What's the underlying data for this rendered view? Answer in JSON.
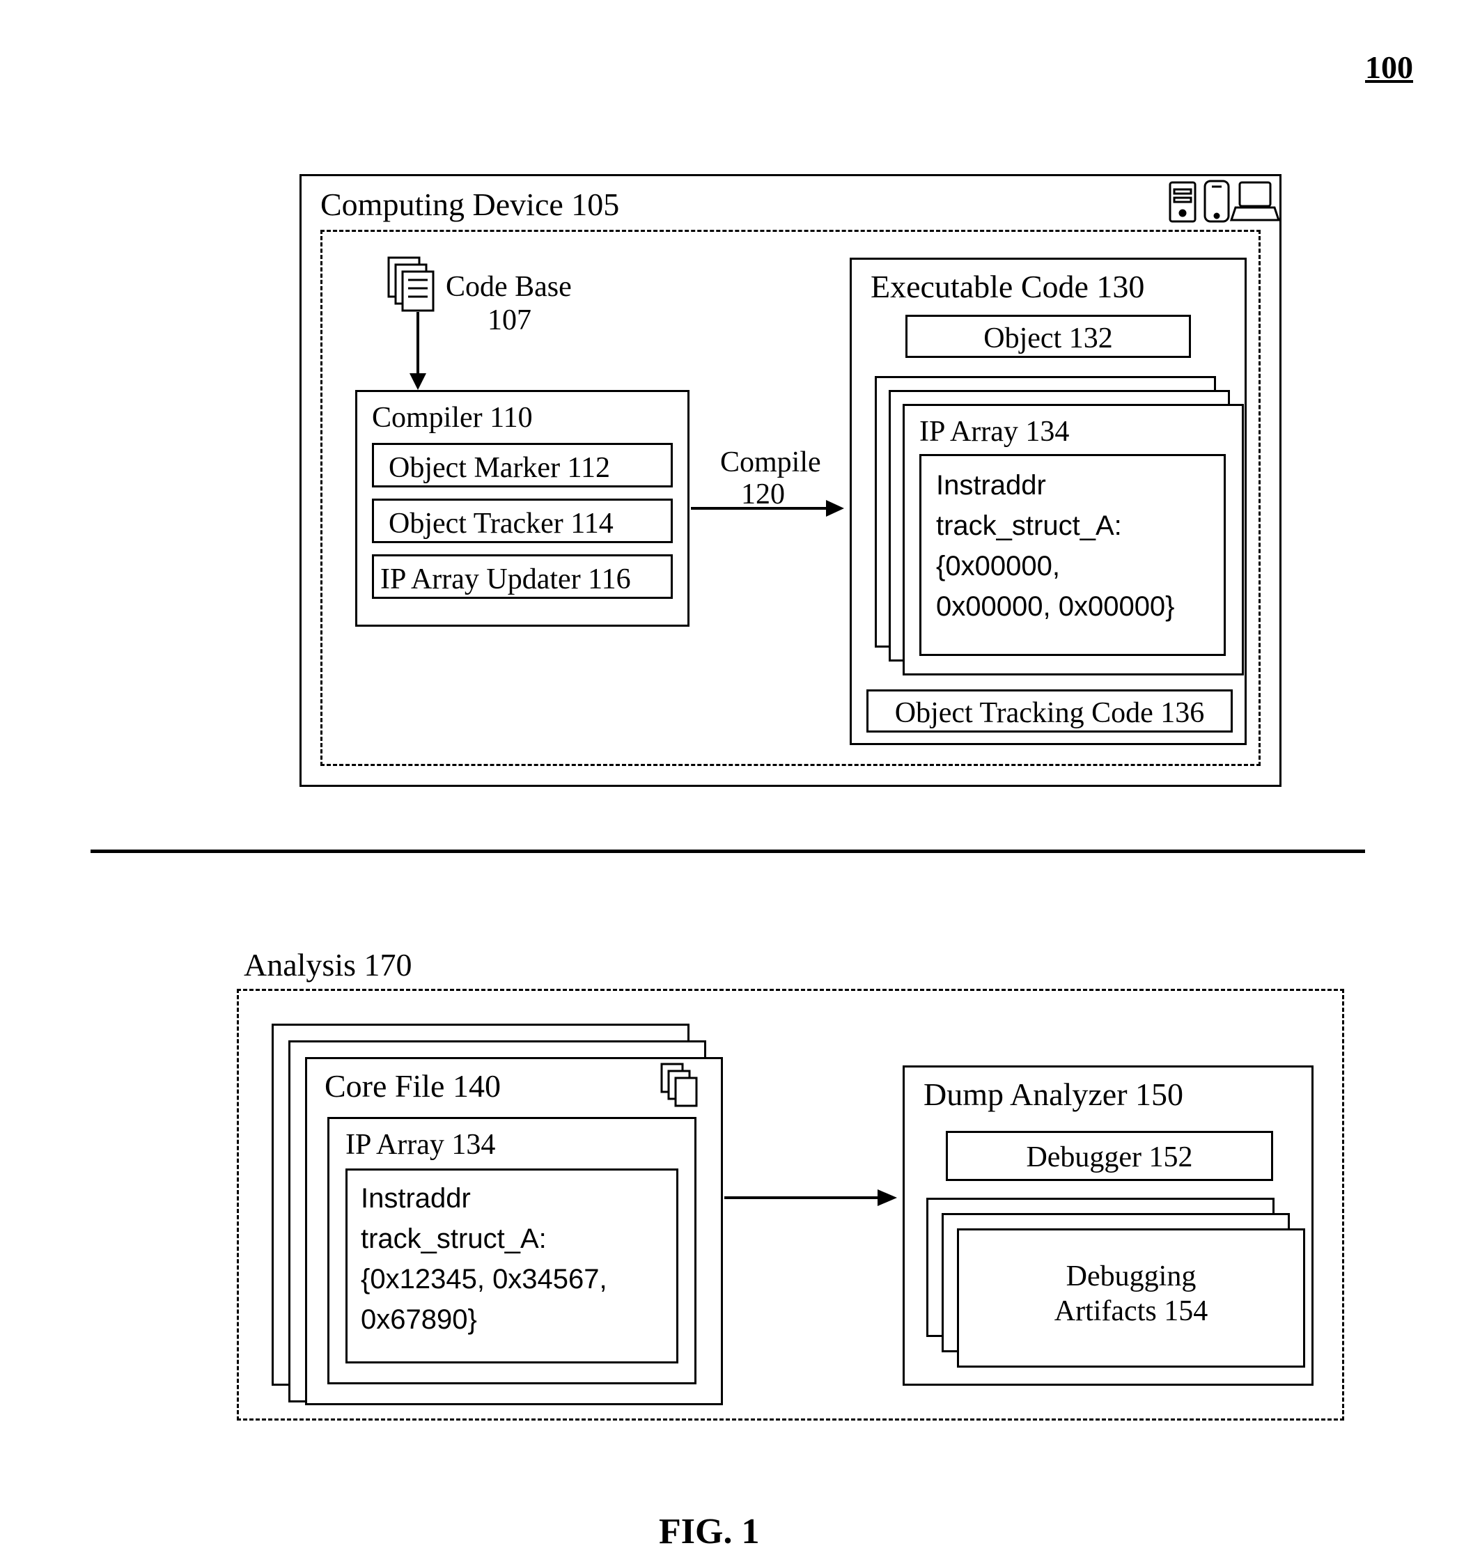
{
  "ref_number": "100",
  "figure_caption": "FIG. 1",
  "computing_device": {
    "title": "Computing Device 105",
    "code_base": {
      "label": "Code Base",
      "num": "107"
    },
    "compiler": {
      "title": "Compiler 110",
      "items": {
        "marker": "Object Marker 112",
        "tracker": "Object Tracker 114",
        "updater": "IP Array Updater 116"
      }
    },
    "compile": {
      "label": "Compile",
      "num": "120"
    },
    "exec": {
      "title": "Executable Code 130",
      "object": "Object 132",
      "ip_array": {
        "title": "IP Array 134",
        "text": "Instraddr\ntrack_struct_A:\n{0x00000,\n0x00000, 0x00000}"
      },
      "tracking": "Object Tracking Code 136"
    }
  },
  "analysis": {
    "title": "Analysis 170",
    "core_file": {
      "title": "Core File 140",
      "ip_array": {
        "title": "IP Array 134",
        "text": "Instraddr\ntrack_struct_A:\n{0x12345, 0x34567,\n0x67890}"
      }
    },
    "dump": {
      "title": "Dump Analyzer 150",
      "debugger": "Debugger 152",
      "artifacts": "Debugging\nArtifacts 154"
    }
  }
}
